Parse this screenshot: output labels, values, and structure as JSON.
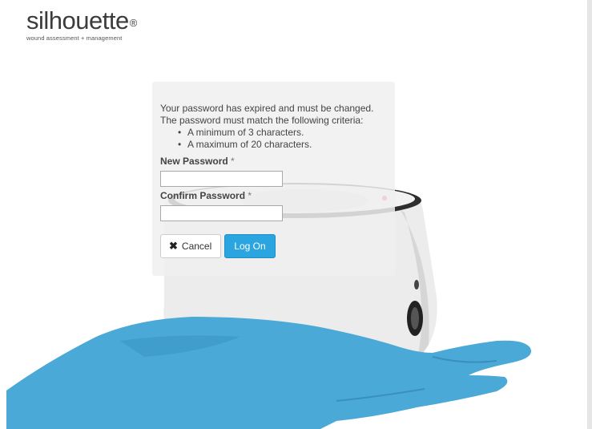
{
  "brand": {
    "name": "silhouette",
    "registered_mark": "®",
    "tagline": "wound assessment + management"
  },
  "dialog": {
    "message_line1": "Your password has expired and must be changed.",
    "message_line2": "The password must match the following criteria:",
    "criteria": [
      "A minimum of 3 characters.",
      "A maximum of 20 characters."
    ],
    "new_password": {
      "label": "New Password",
      "required_marker": "*",
      "value": ""
    },
    "confirm_password": {
      "label": "Confirm Password",
      "required_marker": "*",
      "value": ""
    },
    "cancel_label": "Cancel",
    "cancel_icon": "close-icon",
    "logon_label": "Log On"
  },
  "colors": {
    "glove": "#4aa9d6",
    "logon_button": "#2aa5e0",
    "device_body": "#ececec"
  }
}
